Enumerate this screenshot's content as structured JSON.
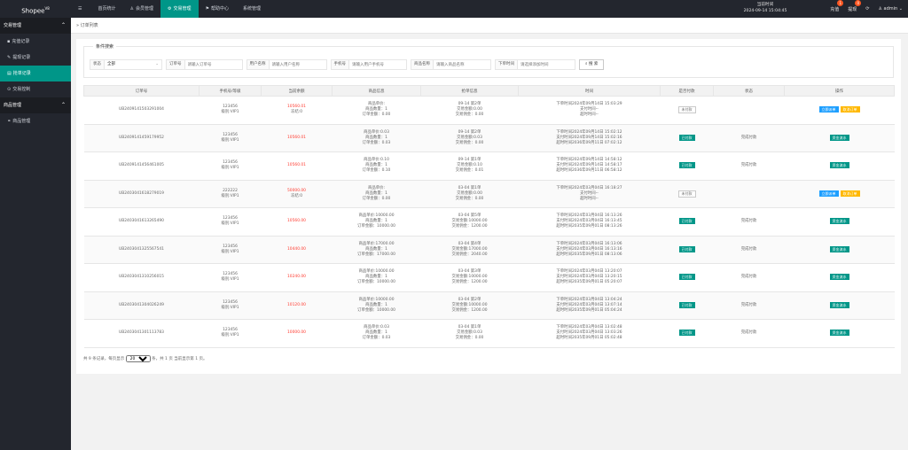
{
  "brand": {
    "name": "Shopee",
    "sup": "V8"
  },
  "topnav": [
    {
      "icon": "☰",
      "label": ""
    },
    {
      "icon": "",
      "label": "首页统计"
    },
    {
      "icon": "♙",
      "label": "会员管理"
    },
    {
      "icon": "⚙",
      "label": "交易管理"
    },
    {
      "icon": "⚑",
      "label": "帮助中心"
    },
    {
      "icon": "",
      "label": "系统管理"
    }
  ],
  "clock": {
    "label": "当前时间",
    "value": "2024-09-14 15:04:45"
  },
  "topright": {
    "recharge": "充值",
    "recharge_count": "1",
    "withdraw": "提现",
    "withdraw_count": "0",
    "refresh": "⟳",
    "user": "admin"
  },
  "sidebar": {
    "group1": "交易管理",
    "items1": [
      {
        "icon": "▪",
        "label": "充值记录"
      },
      {
        "icon": "✎",
        "label": "提现记录"
      },
      {
        "icon": "▤",
        "label": "抢单记录"
      },
      {
        "icon": "⊙",
        "label": "交易控制"
      }
    ],
    "group2": "商品管理",
    "items2": [
      {
        "icon": "⚭",
        "label": "商品管理"
      }
    ]
  },
  "breadcrumb": "» 订单列表",
  "filter": {
    "legend": "条件搜索",
    "status_label": "状态",
    "status_value": "全部",
    "order_label": "订单号",
    "order_ph": "请输入订单号",
    "user_label": "用户名称",
    "user_ph": "请输入用户名称",
    "phone_label": "手机号",
    "phone_ph": "请输入用户手机号",
    "goods_label": "商品名称",
    "goods_ph": "请输入商品名称",
    "time_label": "下单时间",
    "time_ph": "请选择添加时间",
    "search_btn": "搜 索"
  },
  "table": {
    "headers": [
      "订单号",
      "手机号/等级",
      "当前余额",
      "商品信息",
      "抢单信息",
      "时间",
      "是否付款",
      "状态",
      "操作"
    ],
    "rows": [
      {
        "order": "UB2409141503291004",
        "user": "123456",
        "level": "级别:VIP1",
        "balance": "10560.01",
        "frozen": "冻结:0",
        "g1": "商品单价:",
        "g2": "商品数量：1",
        "g3": "订单金额：0.00",
        "q1": "09-14 第2单",
        "q2": "交易金额:0.00",
        "q3": "交易佣金：0.00",
        "t1": "下单时间2024年09月14日 15:03:29",
        "t2": "支付时间--",
        "t3": "超时时间--",
        "pay": "未付款",
        "pay_type": "white",
        "status": "",
        "op1": "立即派单",
        "op2": "取消订单"
      },
      {
        "order": "UB2409141459179952",
        "user": "123456",
        "level": "级别:VIP1",
        "balance": "10560.01",
        "frozen": "",
        "g1": "商品单价:0.03",
        "g2": "商品数量：1",
        "g3": "订单金额：0.03",
        "q1": "09-14 第2单",
        "q2": "交易金额:0.03",
        "q3": "交易佣金：0.00",
        "t1": "下单时间2024年09月14日 15:02:12",
        "t2": "支付时间2024年09月14日 15:02:16",
        "t3": "超时时间2036年09月11日 07:02:12",
        "pay": "已付款",
        "pay_type": "green",
        "status": "完成付款",
        "op1": "",
        "op2": "资金流水"
      },
      {
        "order": "UB2409141456461005",
        "user": "123456",
        "level": "级别:VIP1",
        "balance": "10560.01",
        "frozen": "",
        "g1": "商品单价:0.10",
        "g2": "商品数量：1",
        "g3": "订单金额：0.10",
        "q1": "09-14 第1单",
        "q2": "交易金额:0.10",
        "q3": "交易佣金：0.01",
        "t1": "下单时间2024年09月14日 14:58:12",
        "t2": "支付时间2024年09月14日 14:58:17",
        "t3": "超时时间2036年09月11日 06:58:12",
        "pay": "已付款",
        "pay_type": "green",
        "status": "完成付款",
        "op1": "",
        "op2": "资金流水"
      },
      {
        "order": "UB2403041618279019",
        "user": "222222",
        "level": "级别:VIP1",
        "balance": "50000.00",
        "frozen": "冻结:0",
        "g1": "商品单价:",
        "g2": "商品数量：1",
        "g3": "订单金额：0.00",
        "q1": "03-04 第1单",
        "q2": "交易金额:0.00",
        "q3": "交易佣金：0.00",
        "t1": "下单时间2024年03月04日 16:18:27",
        "t2": "支付时间--",
        "t3": "超时时间--",
        "pay": "未付款",
        "pay_type": "white",
        "status": "",
        "op1": "立即派单",
        "op2": "取消订单"
      },
      {
        "order": "UB2403041613265490",
        "user": "123456",
        "level": "级别:VIP1",
        "balance": "10560.00",
        "frozen": "",
        "g1": "商品单价:10000.00",
        "g2": "商品数量：1",
        "g3": "订单金额：10000.00",
        "q1": "03-04 第5单",
        "q2": "交易金额:10000.00",
        "q3": "交易佣金：1200.00",
        "t1": "下单时间2024年03月04日 16:13:26",
        "t2": "支付时间2024年03月04日 16:13:45",
        "t3": "超时时间2035年09月01日 08:13:26",
        "pay": "已付款",
        "pay_type": "green",
        "status": "完成付款",
        "op1": "",
        "op2": "资金流水"
      },
      {
        "order": "UB2403041325567541",
        "user": "123456",
        "level": "级别:VIP1",
        "balance": "10440.00",
        "frozen": "",
        "g1": "商品单价:17000.00",
        "g2": "商品数量：1",
        "g3": "订单金额：17000.00",
        "q1": "03-04 第4单",
        "q2": "交易金额:17000.00",
        "q3": "交易佣金：2040.00",
        "t1": "下单时间2024年03月04日 16:13:06",
        "t2": "支付时间2024年03月04日 16:13:16",
        "t3": "超时时间2035年09月01日 08:13:06",
        "pay": "已付款",
        "pay_type": "green",
        "status": "完成付款",
        "op1": "",
        "op2": "资金流水"
      },
      {
        "order": "UB2403041310256015",
        "user": "123456",
        "level": "级别:VIP1",
        "balance": "10240.00",
        "frozen": "",
        "g1": "商品单价:10000.00",
        "g2": "商品数量：1",
        "g3": "订单金额：10000.00",
        "q1": "03-04 第3单",
        "q2": "交易金额:10000.00",
        "q3": "交易佣金：1200.00",
        "t1": "下单时间2024年03月04日 13:20:07",
        "t2": "支付时间2024年03月04日 13:20:15",
        "t3": "超时时间2035年09月01日 05:20:07",
        "pay": "已付款",
        "pay_type": "green",
        "status": "完成付款",
        "op1": "",
        "op2": "资金流水"
      },
      {
        "order": "UB2403041304026249",
        "user": "123456",
        "level": "级别:VIP1",
        "balance": "10120.00",
        "frozen": "",
        "g1": "商品单价:10000.00",
        "g2": "商品数量：1",
        "g3": "订单金额：10000.00",
        "q1": "03-04 第2单",
        "q2": "交易金额:10000.00",
        "q3": "交易佣金：1200.00",
        "t1": "下单时间2024年03月04日 13:04:24",
        "t2": "支付时间2024年03月04日 13:07:14",
        "t3": "超时时间2035年09月01日 05:04:24",
        "pay": "已付款",
        "pay_type": "green",
        "status": "完成付款",
        "op1": "",
        "op2": "资金流水"
      },
      {
        "order": "UB2403041301113783",
        "user": "123456",
        "level": "级别:VIP1",
        "balance": "10000.00",
        "frozen": "",
        "g1": "商品单价:0.03",
        "g2": "商品数量：1",
        "g3": "订单金额：0.03",
        "q1": "03-04 第1单",
        "q2": "交易金额:0.03",
        "q3": "交易佣金：0.00",
        "t1": "下单时间2024年03月04日 13:02:48",
        "t2": "支付时间2024年03月04日 13:03:26",
        "t3": "超时时间2035年09月01日 05:02:48",
        "pay": "已付款",
        "pay_type": "green",
        "status": "完成付款",
        "op1": "",
        "op2": "资金流水"
      }
    ]
  },
  "pagination": {
    "prefix": "共 9 条记录，每页显示",
    "size": "20",
    "suffix": "条，共 1 页 当前显示第 1 页。"
  }
}
